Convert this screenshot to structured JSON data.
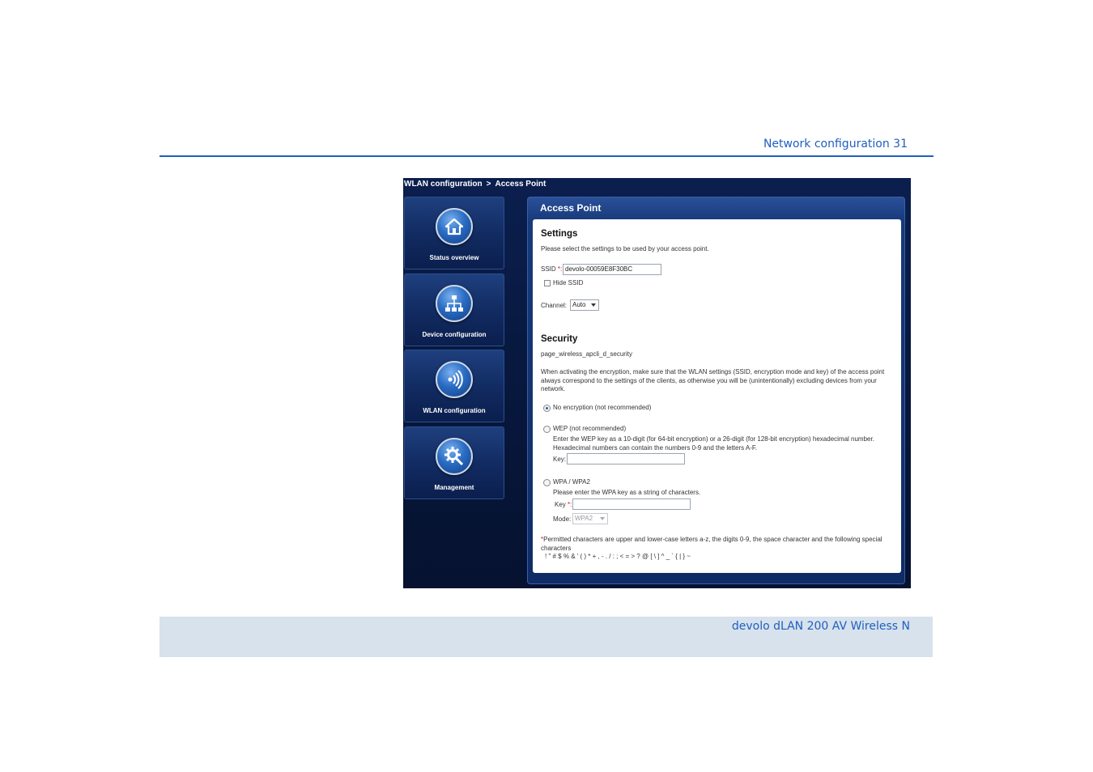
{
  "page": {
    "header": "Network configuration 31",
    "footer": "devolo dLAN 200 AV Wireless N"
  },
  "breadcrumb": {
    "section": "WLAN configuration",
    "separator": ">",
    "page": "Access Point"
  },
  "nav": [
    {
      "label": "Status overview",
      "icon": "home-icon"
    },
    {
      "label": "Device configuration",
      "icon": "network-icon"
    },
    {
      "label": "WLAN configuration",
      "icon": "wireless-icon"
    },
    {
      "label": "Management",
      "icon": "gear-icon"
    }
  ],
  "panel": {
    "title": "Access Point",
    "settings": {
      "heading": "Settings",
      "description": "Please select the settings to be used by your access point.",
      "ssid_label": "SSID",
      "required_mark": "*:",
      "ssid_value": "devolo-00059E8F30BC",
      "hide_ssid_label": "Hide SSID",
      "hide_ssid_checked": false,
      "channel_label": "Channel:",
      "channel_value": "Auto"
    },
    "security": {
      "heading": "Security",
      "key_name": "page_wireless_apcli_d_security",
      "note": "When activating the encryption, make sure that the WLAN settings (SSID, encryption mode and key) of the access point always correspond to the settings of the clients, as otherwise you will be (unintentionally) excluding devices from your network.",
      "options": {
        "none": {
          "label": "No encryption (not recommended)",
          "selected": true
        },
        "wep": {
          "label": "WEP (not recommended)",
          "selected": false,
          "hint": "Enter the WEP key as a 10-digit (for 64-bit encryption) or a 26-digit (for 128-bit encryption) hexadecimal number. Hexadecimal numbers can contain the numbers 0-9 and the letters A-F.",
          "key_label": "Key:",
          "key_value": ""
        },
        "wpa": {
          "label": "WPA / WPA2",
          "selected": false,
          "hint": "Please enter the WPA key as a string of characters.",
          "key_label": "Key",
          "key_required": "*:",
          "key_value": "",
          "mode_label": "Mode:",
          "mode_value": "WPA2"
        }
      },
      "footnote_mark": "*",
      "footnote": "Permitted characters are upper and lower-case letters a-z, the digits 0-9, the space character and the following special characters",
      "special_chars": "! \" # $ % & ' ( ) * + , - . / : ; < = > ? @ [ \\ ] ^ _ ` { | } ~"
    }
  },
  "colors": {
    "accent": "#1f5fbf",
    "footer_bg": "#d7e2ed",
    "app_bg": "#0b1f4e"
  }
}
